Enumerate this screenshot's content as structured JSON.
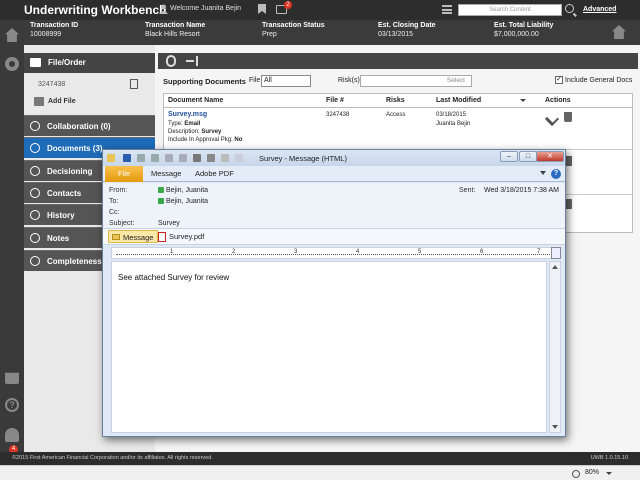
{
  "app": {
    "title": "Underwriting Workbench",
    "welcome": "Welcome Juanita Bejin",
    "message_badge": "2",
    "search_placeholder": "Search Content",
    "advanced_label": "Advanced",
    "notification_badge": "4"
  },
  "transaction": {
    "id_label": "Transaction ID",
    "id_value": "10008999",
    "name_label": "Transaction Name",
    "name_value": "Black Hills Resort",
    "status_label": "Transaction Status",
    "status_value": "Prep",
    "closing_label": "Est. Closing Date",
    "closing_value": "03/13/2015",
    "liability_label": "Est. Total Liability",
    "liability_value": "$7,000,000.00"
  },
  "nav": {
    "file_order": "File/Order",
    "file_number": "3247438",
    "add_file": "Add File",
    "items": [
      {
        "label": "Collaboration (0)",
        "icon": "collaboration-icon"
      },
      {
        "label": "Documents (3)",
        "icon": "paperclip-icon"
      },
      {
        "label": "Decisioning",
        "icon": "gavel-icon"
      },
      {
        "label": "Contacts",
        "icon": "contacts-icon"
      },
      {
        "label": "History",
        "icon": "clock-icon"
      },
      {
        "label": "Notes",
        "icon": "notes-icon"
      },
      {
        "label": "Completeness",
        "icon": "checklist-icon"
      }
    ]
  },
  "documents": {
    "supporting_label": "Supporting Documents",
    "file_label": "File",
    "file_value": "All",
    "risks_label": "Risk(s)",
    "risks_placeholder": "Select",
    "include_general": "Include General Docs",
    "columns": [
      "Document Name",
      "File #",
      "Risks",
      "Last Modified",
      "Actions"
    ],
    "row": {
      "name": "Survey.msg",
      "type_label": "Type:",
      "type_value": "Email",
      "desc_label": "Description:",
      "desc_value": "Survey",
      "include_label": "Include In Approval Pkg:",
      "include_value": "No",
      "file_num": "3247438",
      "risks": "Access",
      "modified_date": "03/18/2015",
      "modified_by": "Juanita Bejin"
    }
  },
  "footer": {
    "copyright": "©2015 First American Financial Corporation and/or its affiliates. All rights reserved.",
    "version": "UWB 1.0.15.10",
    "zoom": "80%"
  },
  "message": {
    "title": "Survey - Message (HTML)",
    "tabs": [
      "File",
      "Message",
      "Adobe PDF"
    ],
    "from_label": "From:",
    "from_value": "Bejin, Juanita",
    "to_label": "To:",
    "to_value": "Bejin, Juanita",
    "cc_label": "Cc:",
    "subject_label": "Subject:",
    "subject_value": "Survey",
    "sent_label": "Sent:",
    "sent_value": "Wed 3/18/2015 7:38 AM",
    "attach_message": "Message",
    "attach_pdf": "Survey.pdf",
    "ruler_numbers": [
      "1",
      "2",
      "3",
      "4",
      "5",
      "6",
      "7"
    ],
    "body": "See attached Survey for review"
  }
}
